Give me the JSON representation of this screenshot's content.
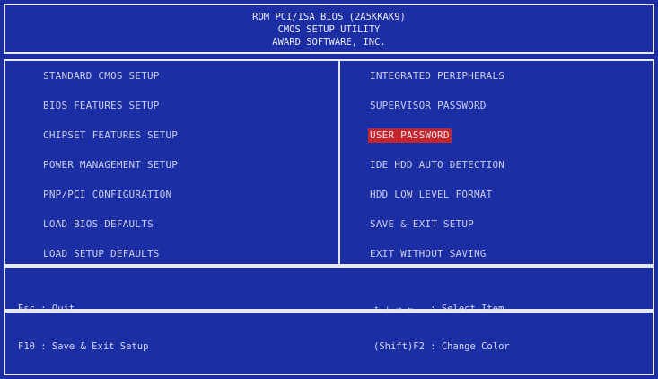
{
  "header": {
    "line1": "ROM PCI/ISA BIOS (2A5KKAK9)",
    "line2": "CMOS SETUP UTILITY",
    "line3": "AWARD SOFTWARE, INC."
  },
  "menu": {
    "left": [
      "STANDARD CMOS SETUP",
      "BIOS FEATURES SETUP",
      "CHIPSET FEATURES SETUP",
      "POWER MANAGEMENT SETUP",
      "PNP/PCI CONFIGURATION",
      "LOAD BIOS DEFAULTS",
      "LOAD SETUP DEFAULTS"
    ],
    "right": [
      "INTEGRATED PERIPHERALS",
      "SUPERVISOR PASSWORD",
      "USER PASSWORD",
      "IDE HDD AUTO DETECTION",
      "HDD LOW LEVEL FORMAT",
      "SAVE & EXIT SETUP",
      "EXIT WITHOUT SAVING"
    ],
    "selected": "USER PASSWORD"
  },
  "help": {
    "left_line1": "Esc : Quit",
    "left_line2": "F10 : Save & Exit Setup",
    "right_line1": "↑ ↓ → ←   : Select Item",
    "right_line2": "(Shift)F2 : Change Color"
  },
  "colors": {
    "background": "#1c2ea3",
    "border": "#e6e8f2",
    "text": "#c9cde6",
    "selected_bg": "#c2262e"
  }
}
